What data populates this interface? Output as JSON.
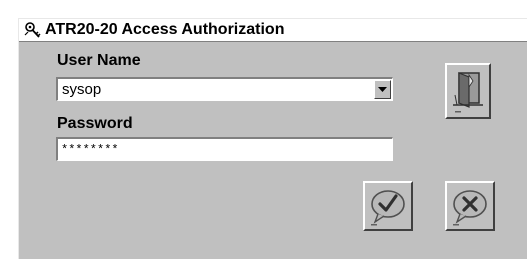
{
  "window": {
    "title": "ATR20-20 Access Authorization"
  },
  "form": {
    "username_label": "User Name",
    "username_value": "sysop",
    "password_label": "Password",
    "password_value": "********"
  },
  "icons": {
    "title": "key-icon",
    "door": "exit-door-icon",
    "ok": "checkmark-icon",
    "cancel": "cancel-x-icon",
    "dropdown": "dropdown-arrow-icon"
  }
}
